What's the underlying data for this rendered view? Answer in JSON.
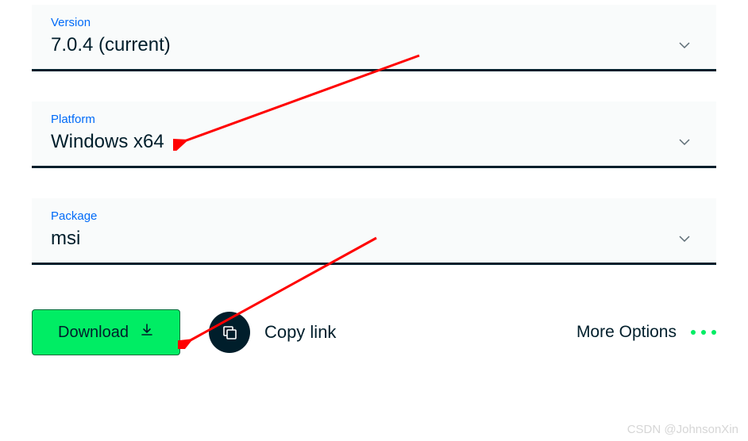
{
  "fields": {
    "version": {
      "label": "Version",
      "value": "7.0.4 (current)"
    },
    "platform": {
      "label": "Platform",
      "value": "Windows x64"
    },
    "package": {
      "label": "Package",
      "value": "msi"
    }
  },
  "actions": {
    "download_label": "Download",
    "copy_link_label": "Copy link",
    "more_options_label": "More Options"
  },
  "watermark": "CSDN @JohnsonXin"
}
